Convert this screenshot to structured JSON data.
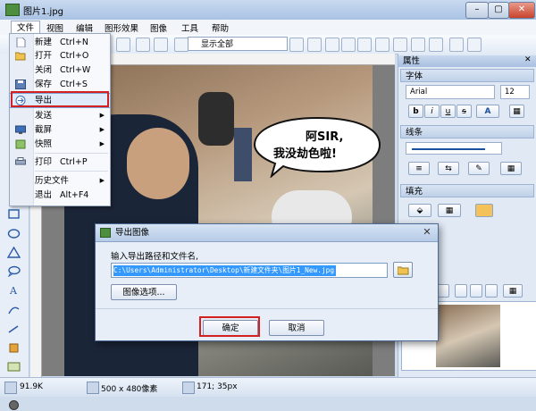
{
  "window": {
    "title": "图片1.jpg",
    "min_label": "–",
    "max_label": "▢",
    "close_label": "✕"
  },
  "menubar": {
    "items": [
      "文件",
      "视图",
      "编辑",
      "图形效果",
      "图像",
      "工具",
      "帮助"
    ]
  },
  "toolbar": {
    "zoom_value": "显示全部"
  },
  "file_menu": {
    "items": [
      {
        "label": "新建",
        "shortcut": "Ctrl+N",
        "icon": "new-file-icon"
      },
      {
        "label": "打开",
        "shortcut": "Ctrl+O",
        "icon": "folder-open-icon"
      },
      {
        "label": "关闭",
        "shortcut": "Ctrl+W",
        "icon": ""
      },
      {
        "label": "保存",
        "shortcut": "Ctrl+S",
        "icon": "save-icon"
      },
      {
        "label": "导出",
        "shortcut": "",
        "icon": "export-icon",
        "highlighted": true
      },
      {
        "label": "发送",
        "shortcut": "",
        "submenu": true
      },
      {
        "label": "截屏",
        "shortcut": "",
        "icon": "screenshot-icon",
        "submenu": true
      },
      {
        "label": "快照",
        "shortcut": "",
        "icon": "snapshot-icon",
        "submenu": true
      },
      {
        "label": "打印",
        "shortcut": "Ctrl+P",
        "icon": "print-icon"
      },
      {
        "label": "历史文件",
        "shortcut": "",
        "submenu": true
      },
      {
        "label": "退出",
        "shortcut": "Alt+F4",
        "icon": ""
      }
    ]
  },
  "canvas": {
    "bubble_text_line1": "阿SIR,",
    "bubble_text_line2": "我没劫色啦!"
  },
  "properties_panel": {
    "title": "属性",
    "font_section": "字体",
    "font_name": "Arial",
    "font_size": "12",
    "bold": "b",
    "italic": "i",
    "underline": "u",
    "strike": "s",
    "text_color": "A",
    "line_section": "线条",
    "fill_section": "填充"
  },
  "dialog": {
    "title": "导出图像",
    "prompt": "输入导出路径和文件名,",
    "path_value": "C:\\Users\\Administrator\\Desktop\\新建文件夹\\图片1_New.jpg",
    "options_label": "图像选项...",
    "ok_label": "确定",
    "cancel_label": "取消"
  },
  "statusbar": {
    "file_size": "91.9K",
    "dimensions": "500 x 480像素",
    "cursor": "171; 35px"
  },
  "colors": {
    "accent": "#3399ff",
    "highlight_border": "#d32020"
  }
}
